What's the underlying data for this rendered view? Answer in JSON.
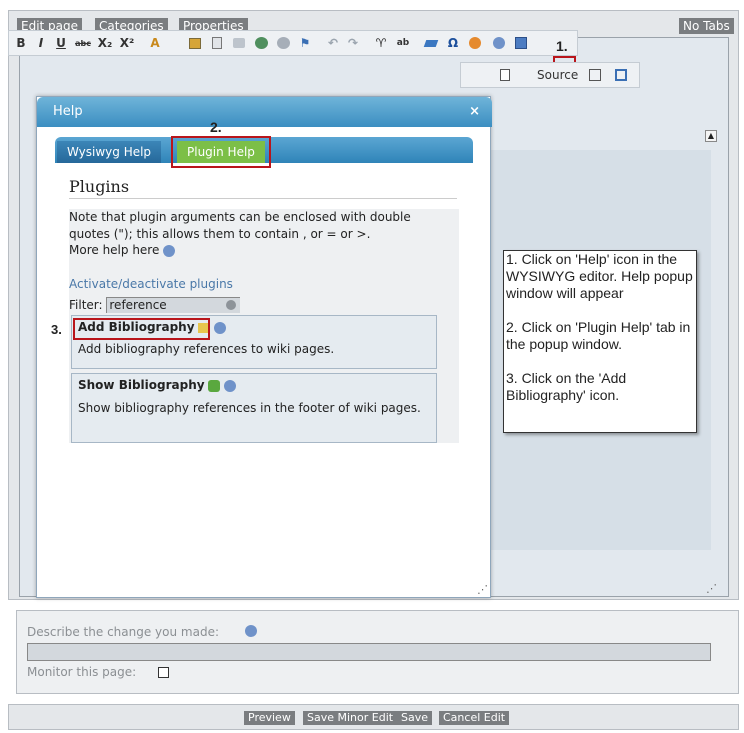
{
  "top_tabs": [
    "Edit page",
    "Categories",
    "Properties"
  ],
  "no_tabs": "No Tabs",
  "toolbar": {
    "bold": "B",
    "italic": "I",
    "underline": "U",
    "strike": "abc",
    "subscript": "X₂",
    "superscript": "X²",
    "font_color": "A",
    "source_label": "Source"
  },
  "help_dialog": {
    "title": "Help",
    "tab_wysiwyg": "Wysiwyg Help",
    "tab_plugin": "Plugin Help",
    "heading": "Plugins",
    "note": "Note that plugin arguments can be enclosed with double quotes (\"); this allows them to contain , or = or >.",
    "more_help": "More help here",
    "activate_link": "Activate/deactivate plugins",
    "filter_label": "Filter:",
    "filter_value": "reference",
    "plugins": [
      {
        "name": "Add Bibliography",
        "desc": "Add bibliography references to wiki pages."
      },
      {
        "name": "Show Bibliography",
        "desc": "Show bibliography references in the footer of wiki pages."
      }
    ]
  },
  "callout": {
    "step1": "1. Click on 'Help' icon in the WYSIWYG editor. Help popup window will appear",
    "step2": "2. Click on 'Plugin Help' tab in the popup window.",
    "step3": "3. Click on the 'Add Bibliography' icon."
  },
  "step_labels": [
    "1.",
    "2.",
    "3."
  ],
  "bottom": {
    "describe_label": "Describe the change you made:",
    "monitor_label": "Monitor this page:"
  },
  "buttons": [
    "Preview",
    "Save Minor Edit",
    "Save",
    "Cancel Edit"
  ]
}
